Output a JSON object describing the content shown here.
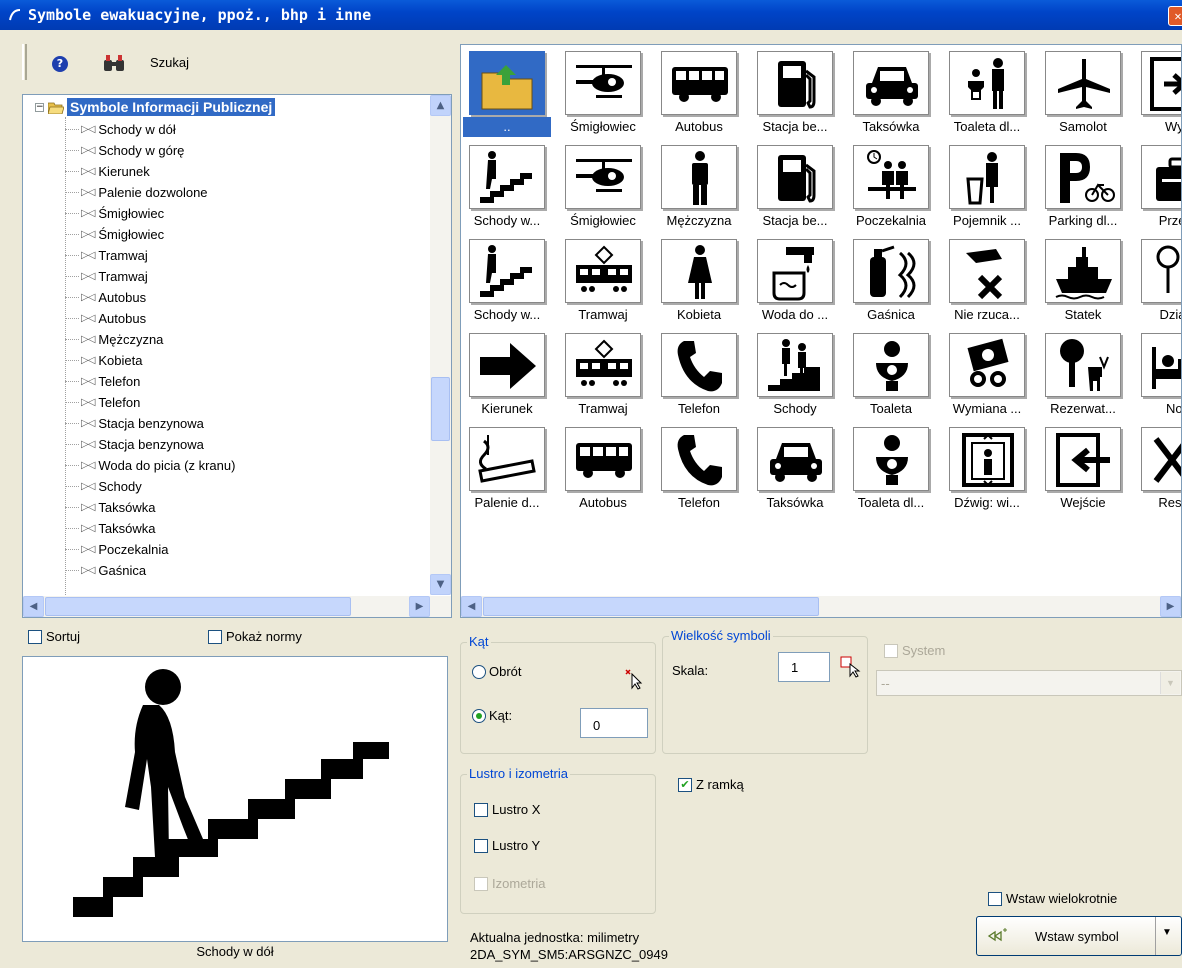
{
  "window": {
    "title": "Symbole ewakuacyjne, ppoż., bhp i inne",
    "close_label": "✕"
  },
  "toolbar": {
    "search_label": "Szukaj",
    "help_glyph": "?"
  },
  "tree": {
    "root_label": "Symbole Informacji Publicznej",
    "items": [
      "Schody w dół",
      "Schody w górę",
      "Kierunek",
      "Palenie dozwolone",
      "Śmigłowiec",
      "Śmigłowiec",
      "Tramwaj",
      "Tramwaj",
      "Autobus",
      "Autobus",
      "Mężczyzna",
      "Kobieta",
      "Telefon",
      "Telefon",
      "Stacja benzynowa",
      "Stacja benzynowa",
      "Woda do picia (z kranu)",
      "Schody",
      "Taksówka",
      "Taksówka",
      "Poczekalnia",
      "Gaśnica"
    ]
  },
  "grid": {
    "rows": [
      [
        "..",
        "Śmigłowiec",
        "Autobus",
        "Stacja be...",
        "Taksówka",
        "Toaleta dl...",
        "Samolot",
        "Wyjś"
      ],
      [
        "Schody w...",
        "Śmigłowiec",
        "Mężczyzna",
        "Stacja be...",
        "Poczekalnia",
        "Pojemnik ...",
        "Parking dl...",
        "Przech"
      ],
      [
        "Schody w...",
        "Tramwaj",
        "Kobieta",
        "Woda do ...",
        "Gaśnica",
        "Nie rzuca...",
        "Statek",
        "Działal"
      ],
      [
        "Kierunek",
        "Tramwaj",
        "Telefon",
        "Schody",
        "Toaleta",
        "Wymiana ...",
        "Rezerwat...",
        "Nocl"
      ],
      [
        "Palenie d...",
        "Autobus",
        "Telefon",
        "Taksówka",
        "Toaleta dl...",
        "Dźwig: wi...",
        "Wejście",
        "Restau"
      ]
    ],
    "icons": [
      [
        "folder-up-icon",
        "helicopter-icon",
        "bus-icon",
        "fuel-pump-icon",
        "taxi-icon",
        "toilet-disabled-icon",
        "airplane-icon",
        "exit-icon"
      ],
      [
        "stairs-down-icon",
        "helicopter-icon",
        "man-icon",
        "fuel-pump-icon",
        "waiting-room-icon",
        "trash-bin-icon",
        "bike-parking-icon",
        "luggage-icon"
      ],
      [
        "stairs-down-icon",
        "tram-icon",
        "woman-icon",
        "drinking-water-icon",
        "fire-extinguisher-icon",
        "no-littering-icon",
        "ship-icon",
        "activity-icon"
      ],
      [
        "arrow-right-icon",
        "tram-icon",
        "telephone-icon",
        "stairs-icon",
        "toilet-icon",
        "money-exchange-icon",
        "nature-reserve-icon",
        "bed-icon"
      ],
      [
        "smoking-icon",
        "bus-icon",
        "telephone-icon",
        "taxi-icon",
        "toilet-icon",
        "elevator-icon",
        "entrance-icon",
        "restaurant-icon"
      ]
    ]
  },
  "options": {
    "sort_label": "Sortuj",
    "show_norms_label": "Pokaż normy",
    "preview_caption": "Schody w dół",
    "angle_group": "Kąt",
    "rotation_label": "Obrót",
    "angle_label": "Kąt:",
    "angle_value": "0",
    "size_group": "Wielkość symboli",
    "scale_label": "Skala:",
    "scale_value": "1",
    "system_label": "System",
    "system_value": "--",
    "mirror_group": "Lustro i izometria",
    "mirror_x": "Lustro X",
    "mirror_y": "Lustro Y",
    "isometry": "Izometria",
    "frame_label": "Z ramką",
    "insert_multiple_label": "Wstaw wielokrotnie",
    "insert_button_label": "Wstaw symbol",
    "unit_text": "Aktualna jednostka: milimetry",
    "code_text": "2DA_SYM_SM5:ARSGNZC_0949"
  },
  "colors": {
    "title_bar": "#0044c8",
    "selection": "#316ac5",
    "group_legend": "#0046d5",
    "check_mark": "#21a121"
  }
}
